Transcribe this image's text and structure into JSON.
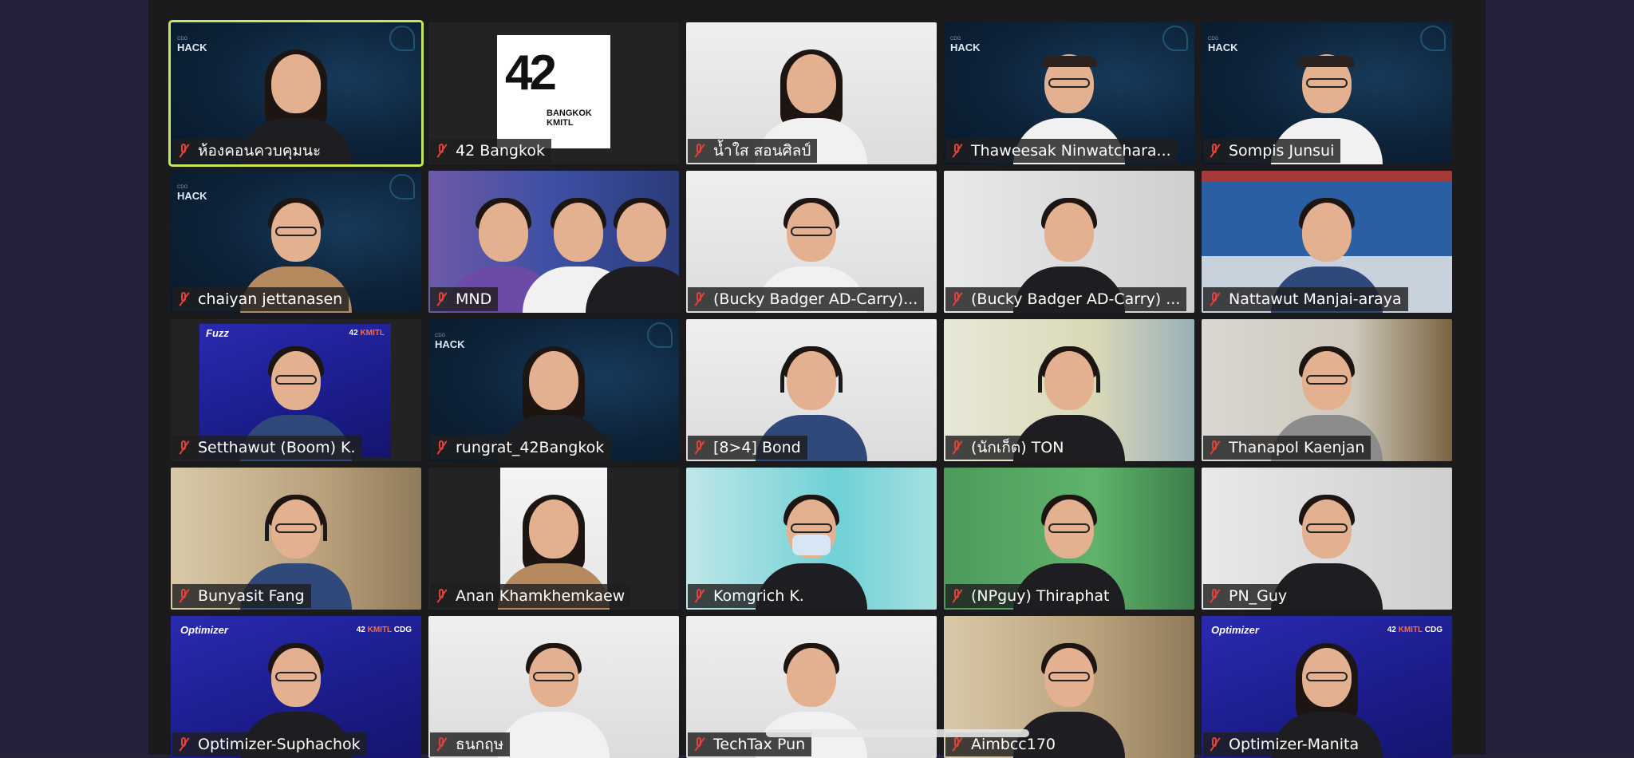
{
  "participants": [
    {
      "name": "ห้องคอนควบคุมนะ"
    },
    {
      "name": "42 Bangkok"
    },
    {
      "name": "น้ำใส สอนศิลป์"
    },
    {
      "name": "Thaweesak Ninwatchara..."
    },
    {
      "name": "Sompis Junsui"
    },
    {
      "name": "chaiyan jettanasen"
    },
    {
      "name": "MND"
    },
    {
      "name": "(Bucky Badger AD-Carry)..."
    },
    {
      "name": "(Bucky Badger AD-Carry) ..."
    },
    {
      "name": "Nattawut Manjai-araya"
    },
    {
      "name": "Setthawut (Boom) K."
    },
    {
      "name": "rungrat_42Bangkok"
    },
    {
      "name": "[8>4] Bond"
    },
    {
      "name": "(นักเก็ต) TON"
    },
    {
      "name": "Thanapol Kaenjan"
    },
    {
      "name": "Bunyasit Fang"
    },
    {
      "name": "Anan Khamkhemkaew"
    },
    {
      "name": "Komgrich K."
    },
    {
      "name": "(NPguy) Thiraphat"
    },
    {
      "name": "PN_Guy"
    },
    {
      "name": "Optimizer-Suphachok"
    },
    {
      "name": "ธนกฤษ"
    },
    {
      "name": "TechTax Pun"
    },
    {
      "name": "Aimbcc170"
    },
    {
      "name": "Optimizer-Manita"
    }
  ],
  "branding": {
    "hack_label": "HACK",
    "hack_sub": "CDG",
    "logo_42": "42",
    "logo_42_sub": "BANGKOK",
    "logo_42_sub2": "KMITL",
    "optimizer_label": "Optimizer",
    "opt_brand_42": "42",
    "opt_brand_kmitl": "KMITL",
    "opt_brand_cdg": "CDG"
  },
  "colors": {
    "active_speaker": "#c6e85a",
    "muted_icon": "#e2423a"
  }
}
